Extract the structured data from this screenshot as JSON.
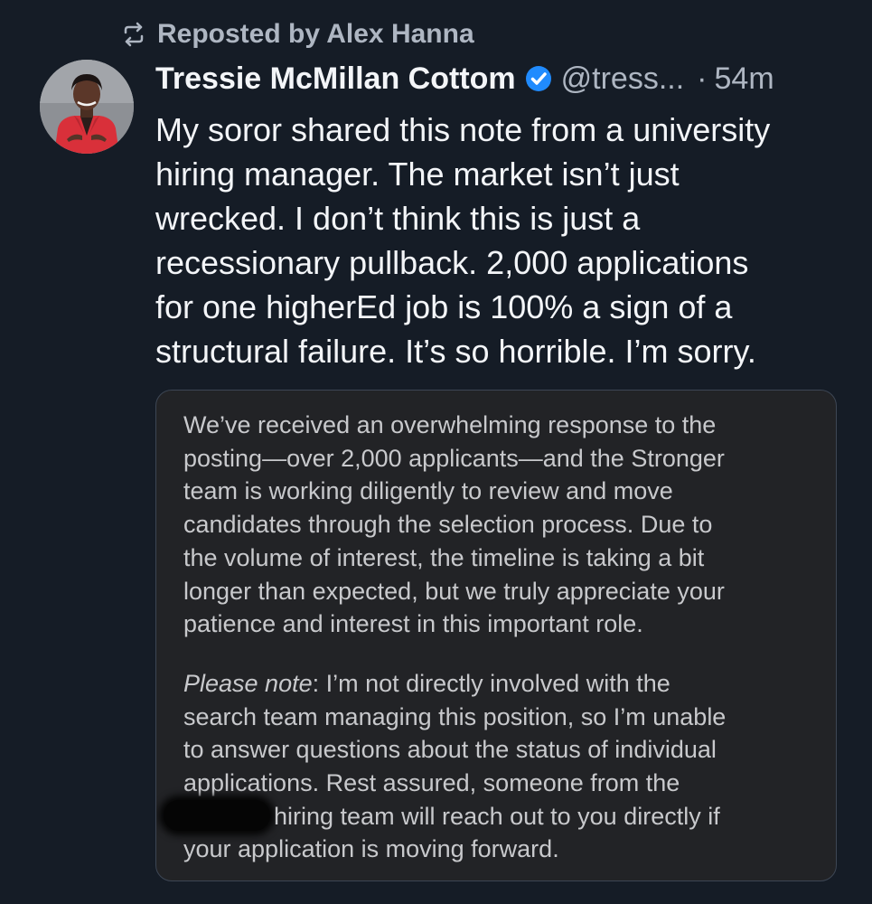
{
  "repost": {
    "label": "Reposted by Alex Hanna",
    "icon": "repost-icon"
  },
  "author": {
    "display_name": "Tressie McMillan Cottom",
    "handle": "@tress...",
    "separator": "·",
    "time": "54m",
    "verified_icon": "verified-check-icon",
    "avatar_description_icon": "avatar"
  },
  "post": {
    "lines": [
      "My soror shared this note from a university",
      "hiring manager. The market isn’t just",
      "wrecked. I don’t think this is just a",
      "recessionary pullback. 2,000 applications",
      "for one higherEd job is 100% a sign of a",
      "structural failure. It’s so horrible. I’m sorry."
    ]
  },
  "embed": {
    "paragraph1": [
      "We’ve received an overwhelming response to the",
      "posting—over 2,000 applicants—and the Stronger",
      "team is working diligently to review and move",
      "candidates through the selection process. Due to",
      "the volume of interest, the timeline is taking a bit",
      "longer than expected, but we truly appreciate your",
      "patience and interest in this important role."
    ],
    "note_label": "Please note",
    "note_first": ": I’m not directly involved with the",
    "paragraph2": [
      "search team managing this position, so I’m unable",
      "to answer questions about the status of individual",
      "applications. Rest assured, someone from the"
    ],
    "redacted_line": "hiring team will reach out to you directly if",
    "last_line": "your application is moving forward."
  },
  "colors": {
    "background": "#151c26",
    "text": "#f3f5f8",
    "muted": "#aeb6c2",
    "verified": "#208bfe",
    "embed_background": "#222326",
    "embed_text": "#c8c9cc",
    "embed_border": "#3d4654"
  }
}
